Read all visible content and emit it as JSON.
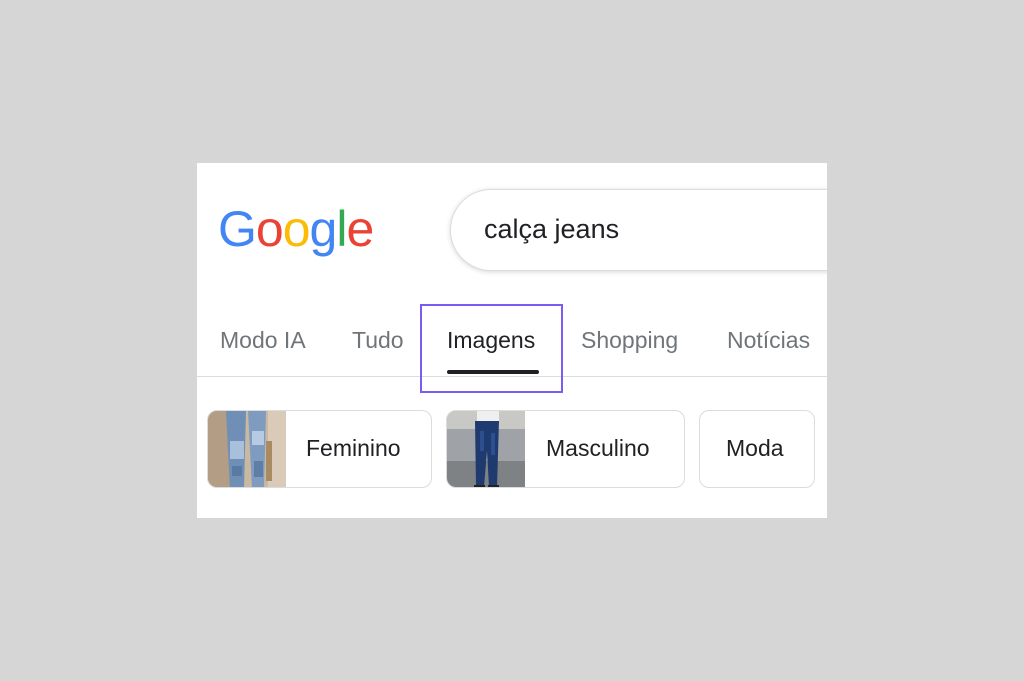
{
  "logo": {
    "letters": [
      "G",
      "o",
      "o",
      "g",
      "l",
      "e"
    ]
  },
  "search": {
    "value": "calça jeans"
  },
  "tabs": [
    {
      "label": "Modo IA"
    },
    {
      "label": "Tudo"
    },
    {
      "label": "Imagens",
      "active": true
    },
    {
      "label": "Shopping"
    },
    {
      "label": "Notícias"
    }
  ],
  "chips": [
    {
      "label": "Feminino",
      "thumbnail": "jeans-women-photo"
    },
    {
      "label": "Masculino",
      "thumbnail": "jeans-men-photo"
    },
    {
      "label": "Moda"
    }
  ],
  "colors": {
    "highlight": "#7b5cf0",
    "google_blue": "#4285F4",
    "google_red": "#EA4335",
    "google_yellow": "#FBBC05",
    "google_green": "#34A853"
  }
}
